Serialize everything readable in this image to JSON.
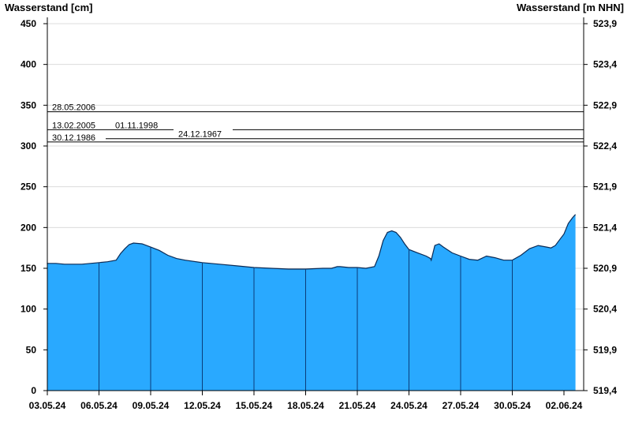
{
  "chart_data": {
    "type": "area",
    "ylabel_left": "Wasserstand [cm]",
    "ylabel_right": "Wasserstand [m NHN]",
    "ylim": [
      0,
      460
    ],
    "left_ticks": [
      0,
      50,
      100,
      150,
      200,
      250,
      300,
      350,
      400,
      450
    ],
    "right_ticks": [
      "519,4",
      "519,9",
      "520,4",
      "520,9",
      "521,4",
      "521,9",
      "522,4",
      "522,9",
      "523,4",
      "523,9"
    ],
    "x_range": [
      "2024-05-02",
      "2024-06-02"
    ],
    "x_ticks": [
      "03.05.24",
      "06.05.24",
      "09.05.24",
      "12.05.24",
      "15.05.24",
      "18.05.24",
      "21.05.24",
      "24.05.24",
      "27.05.24",
      "30.05.24",
      "02.06.24"
    ],
    "x_tick_dates": [
      "2024-05-03",
      "2024-05-06",
      "2024-05-09",
      "2024-05-12",
      "2024-05-15",
      "2024-05-18",
      "2024-05-21",
      "2024-05-24",
      "2024-05-27",
      "2024-05-30",
      "2024-06-02"
    ],
    "grid": true,
    "fill_color": "#29a9ff",
    "reference_levels": [
      {
        "label": "28.05.2006",
        "value": 342
      },
      {
        "label": "13.02.2005",
        "value": 320
      },
      {
        "label": "01.11.1998",
        "value": 320
      },
      {
        "label": "24.12.1967",
        "value": 309
      },
      {
        "label": "30.12.1986",
        "value": 305
      }
    ],
    "series": [
      {
        "x": [
          "2024-05-02 00:00",
          "2024-05-02 12:00",
          "2024-05-03 00:00",
          "2024-05-03 12:00",
          "2024-05-04 00:00",
          "2024-05-04 12:00",
          "2024-05-05 00:00",
          "2024-05-05 12:00",
          "2024-05-06 00:00",
          "2024-05-06 12:00",
          "2024-05-07 00:00",
          "2024-05-07 06:00",
          "2024-05-07 12:00",
          "2024-05-07 18:00",
          "2024-05-08 00:00",
          "2024-05-08 12:00",
          "2024-05-09 00:00",
          "2024-05-09 12:00",
          "2024-05-10 00:00",
          "2024-05-10 12:00",
          "2024-05-11 00:00",
          "2024-05-12 00:00",
          "2024-05-13 00:00",
          "2024-05-14 00:00",
          "2024-05-15 00:00",
          "2024-05-16 00:00",
          "2024-05-17 00:00",
          "2024-05-18 00:00",
          "2024-05-19 00:00",
          "2024-05-19 12:00",
          "2024-05-19 16:00",
          "2024-05-19 20:00",
          "2024-05-20 00:00",
          "2024-05-20 12:00",
          "2024-05-21 00:00",
          "2024-05-21 12:00",
          "2024-05-22 00:00",
          "2024-05-22 06:00",
          "2024-05-22 12:00",
          "2024-05-22 18:00",
          "2024-05-23 00:00",
          "2024-05-23 06:00",
          "2024-05-23 12:00",
          "2024-05-23 18:00",
          "2024-05-24 00:00",
          "2024-05-24 12:00",
          "2024-05-25 00:00",
          "2024-05-25 06:00",
          "2024-05-25 07:00",
          "2024-05-25 12:00",
          "2024-05-25 18:00",
          "2024-05-26 00:00",
          "2024-05-26 12:00",
          "2024-05-27 00:00",
          "2024-05-27 12:00",
          "2024-05-28 00:00",
          "2024-05-28 12:00",
          "2024-05-29 00:00",
          "2024-05-29 12:00",
          "2024-05-30 00:00",
          "2024-05-30 12:00",
          "2024-05-31 00:00",
          "2024-05-31 12:00",
          "2024-06-01 00:00",
          "2024-06-01 06:00",
          "2024-06-01 12:00",
          "2024-06-01 18:00",
          "2024-06-02 00:00",
          "2024-06-02 06:00",
          "2024-06-02 12:00",
          "2024-06-02 16:00"
        ],
        "values": [
          155,
          155,
          156,
          156,
          155,
          155,
          155,
          156,
          157,
          158,
          160,
          168,
          174,
          179,
          181,
          180,
          176,
          172,
          166,
          162,
          160,
          157,
          155,
          153,
          151,
          150,
          149,
          149,
          150,
          150,
          151,
          152,
          152,
          151,
          151,
          150,
          152,
          165,
          184,
          194,
          196,
          194,
          188,
          180,
          173,
          169,
          165,
          162,
          160,
          178,
          180,
          176,
          169,
          165,
          161,
          160,
          165,
          163,
          160,
          160,
          166,
          174,
          178,
          176,
          175,
          178,
          185,
          192,
          205,
          212,
          216
        ]
      }
    ]
  }
}
